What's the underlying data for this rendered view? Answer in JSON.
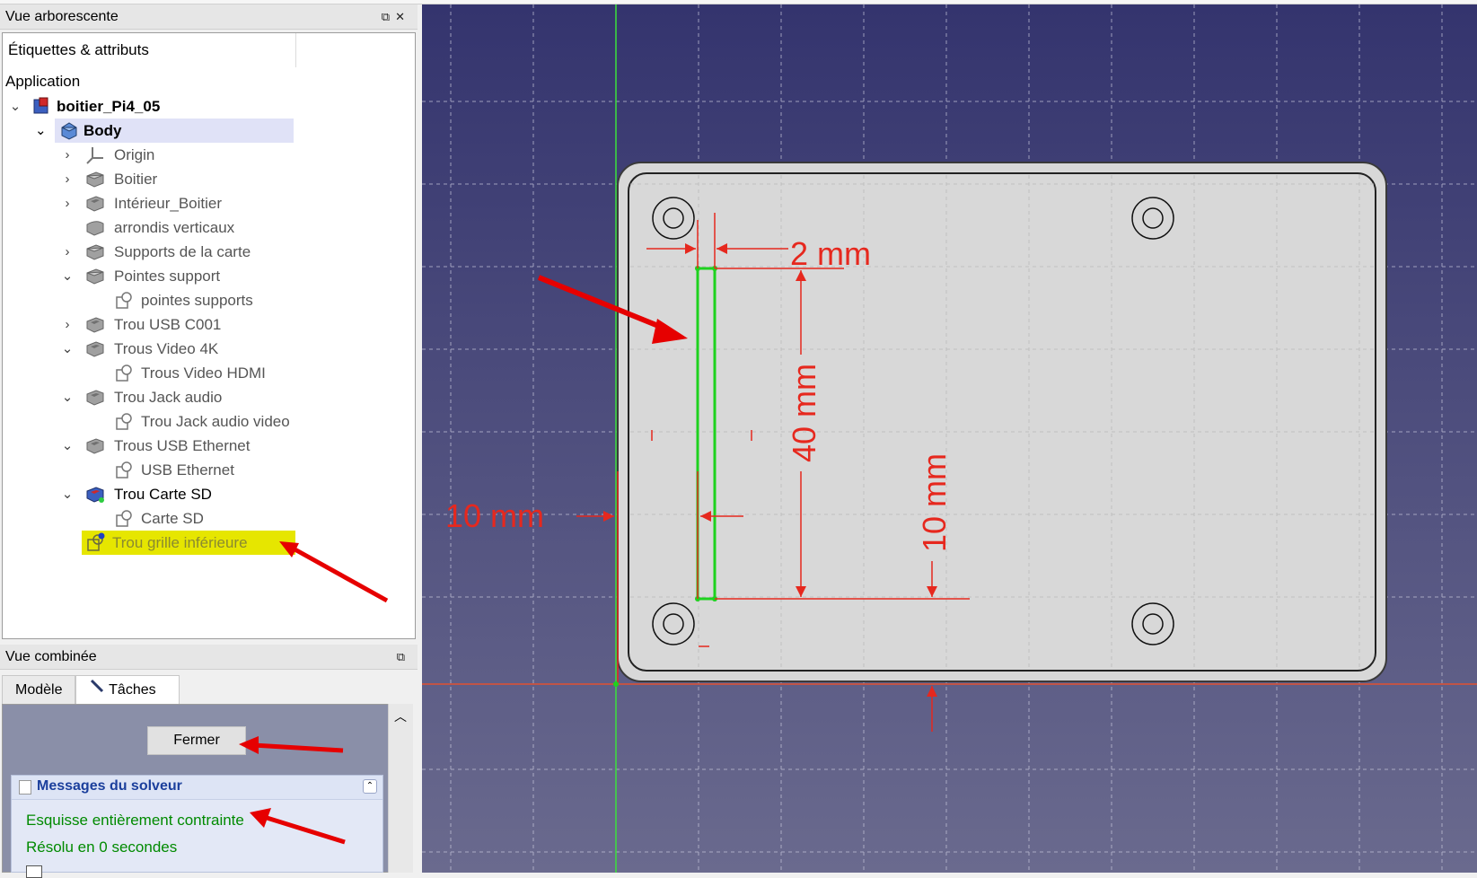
{
  "tree_panel": {
    "title": "Vue arborescente",
    "header": "Étiquettes & attributs",
    "root_label": "Application",
    "items": [
      {
        "label": "boitier_Pi4_05"
      },
      {
        "label": "Body"
      },
      {
        "label": "Origin"
      },
      {
        "label": "Boitier"
      },
      {
        "label": "Intérieur_Boitier"
      },
      {
        "label": "arrondis verticaux"
      },
      {
        "label": "Supports de la carte"
      },
      {
        "label": "Pointes support"
      },
      {
        "label": "pointes supports"
      },
      {
        "label": "Trou USB C001"
      },
      {
        "label": "Trous Video 4K"
      },
      {
        "label": "Trous Video HDMI"
      },
      {
        "label": "Trou Jack audio"
      },
      {
        "label": "Trou Jack audio video"
      },
      {
        "label": "Trous USB Ethernet"
      },
      {
        "label": "USB Ethernet"
      },
      {
        "label": "Trou Carte SD"
      },
      {
        "label": "Carte SD"
      },
      {
        "label": "Trou grille inférieure"
      }
    ]
  },
  "combo_panel": {
    "title": "Vue combinée",
    "tabs": [
      "Modèle",
      "Tâches"
    ],
    "close_button": "Fermer",
    "solver_title": "Messages du solveur",
    "status_line1": "Esquisse entièrement contrainte",
    "status_line2": "Résolu en 0 secondes"
  },
  "viewport": {
    "dimensions": {
      "width_small": "2 mm",
      "height_slot": "40 mm",
      "offset_left": "10 mm",
      "offset_bottom": "10 mm"
    },
    "colors": {
      "background_top": "#34346e",
      "background_bottom": "#6a6a8e",
      "constraint": "#e6281e",
      "sketch_line": "#1ed21e",
      "part_fill": "#d8d8d8"
    }
  }
}
